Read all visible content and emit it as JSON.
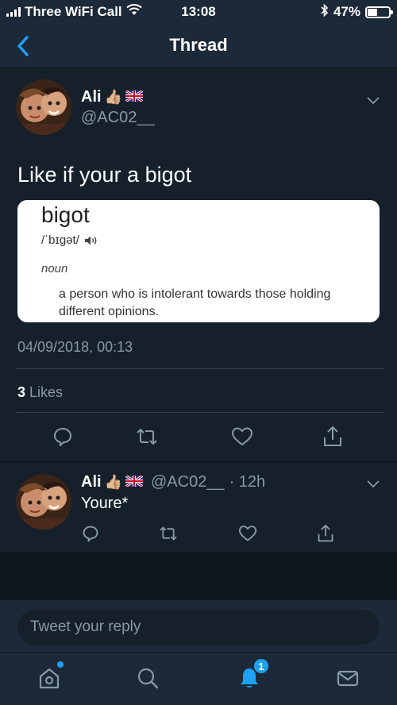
{
  "status_bar": {
    "carrier": "Three WiFi Call",
    "time": "13:08",
    "battery": "47%",
    "battery_level": 0.47
  },
  "nav": {
    "title": "Thread"
  },
  "tweet": {
    "author_name": "Ali",
    "author_emoji": "👍🏼",
    "author_flag": "uk-flag",
    "handle": "@AC02__",
    "text": "Like if your a bigot",
    "card": {
      "word": "bigot",
      "pronunciation": "/ˈbɪɡət/",
      "part_of_speech": "noun",
      "definition": "a person who is intolerant towards those holding different opinions."
    },
    "timestamp": "04/09/2018, 00:13",
    "likes_count": "3",
    "likes_label": "Likes"
  },
  "reply": {
    "author_name": "Ali",
    "author_emoji": "👍🏼",
    "handle": "@AC02__",
    "time": "· 12h",
    "text": "Youre*"
  },
  "composer": {
    "placeholder": "Tweet your reply"
  },
  "tabbar": {
    "notification_count": "1"
  },
  "colors": {
    "background": "#15202b",
    "bar": "#1c2938",
    "accent": "#1da1f2",
    "muted": "#8899a6"
  }
}
